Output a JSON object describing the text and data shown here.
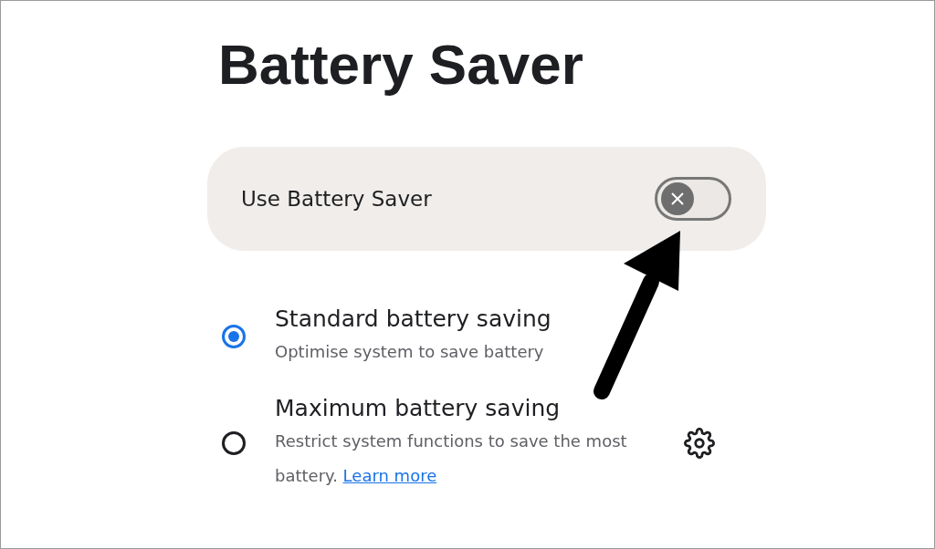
{
  "title": "Battery Saver",
  "master_switch": {
    "label": "Use Battery Saver",
    "on": false
  },
  "options": [
    {
      "title": "Standard battery saving",
      "description": "Optimise system to save battery",
      "selected": true,
      "has_settings": false
    },
    {
      "title": "Maximum battery saving",
      "description": "Restrict system functions to save the most battery.",
      "link": "Learn more",
      "selected": false,
      "has_settings": true
    }
  ]
}
